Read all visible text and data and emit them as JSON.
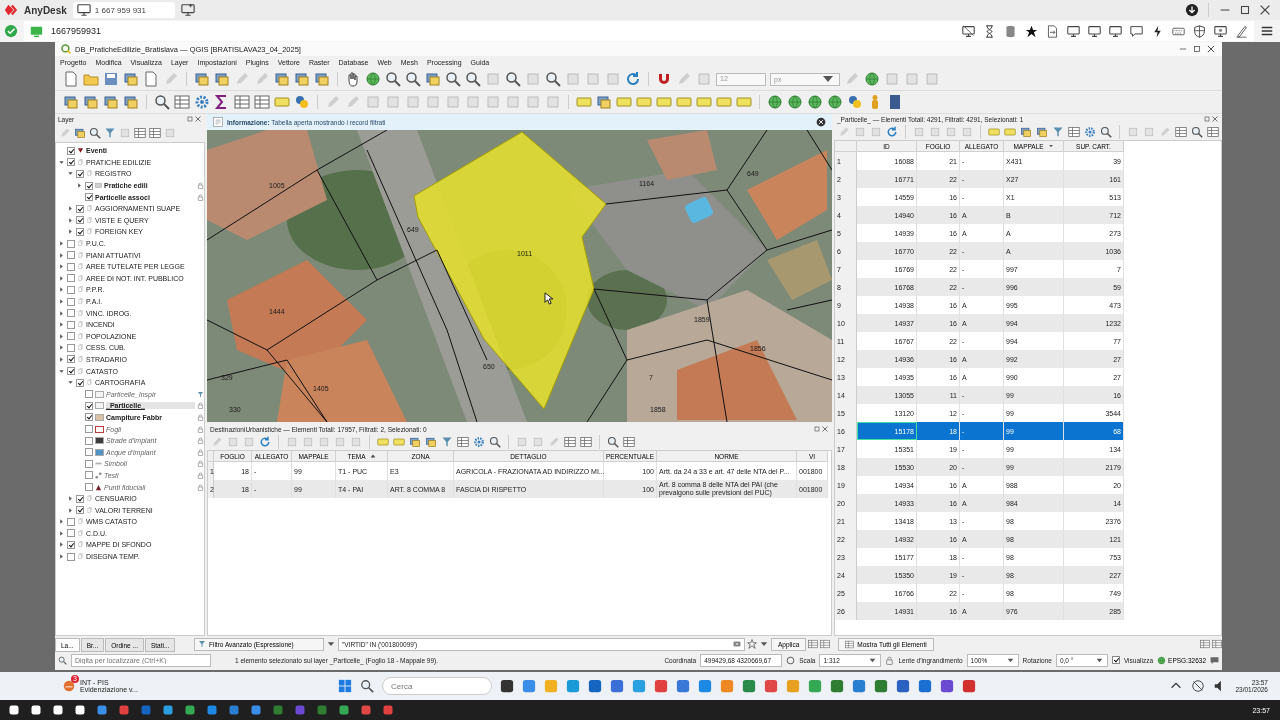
{
  "anydesk": {
    "app_name": "AnyDesk",
    "tab": "1 667 959 931",
    "address": "1667959931"
  },
  "qgis": {
    "title": "DB_PraticheEdilizie_Bratislava — QGIS [BRATISLAVA23_04_2025]",
    "menu": [
      "Progetto",
      "Modifica",
      "Visualizza",
      "Layer",
      "Impostazioni",
      "Plugins",
      "Vettore",
      "Raster",
      "Database",
      "Web",
      "Mesh",
      "Processing",
      "Guida"
    ],
    "toolbar": {
      "size_value": "12",
      "unit": "px"
    }
  },
  "layers_panel": {
    "title": "Layer",
    "tree": [
      {
        "label": "Eventi",
        "kind": "event",
        "checked": true,
        "selected": false
      },
      {
        "label": "PRATICHE EDILIZIE",
        "kind": "group",
        "checked": true,
        "expanded": true,
        "selected": false,
        "children": [
          {
            "label": "REGISTRO",
            "kind": "group",
            "checked": true,
            "expanded": true,
            "selected": false,
            "children": [
              {
                "label": "Pratiche edili",
                "kind": "bold",
                "checked": true,
                "expanded": false,
                "selected": false,
                "indicator": {
                  "kind": "lock"
                },
                "symbol": {
                  "kind": "table",
                  "color": "#d0d0d0"
                }
              },
              {
                "label": "Particelle associ",
                "kind": "bold",
                "checked": true,
                "selected": false,
                "indicator": {
                  "kind": "lock"
                }
              }
            ]
          },
          {
            "label": "AGGIORNAMENTI SUAPE",
            "kind": "group",
            "checked": true,
            "expanded": false,
            "selected": false
          },
          {
            "label": "VISTE E QUERY",
            "kind": "group",
            "checked": true,
            "expanded": false,
            "selected": false
          },
          {
            "label": "FOREIGN KEY",
            "kind": "group",
            "checked": true,
            "expanded": false,
            "selected": false
          }
        ]
      },
      {
        "label": "P.U.C.",
        "kind": "group",
        "checked": false,
        "expanded": false,
        "selected": false
      },
      {
        "label": "PIANI ATTUATIVI",
        "kind": "group",
        "checked": false,
        "expanded": false,
        "selected": false
      },
      {
        "label": "AREE TUTELATE PER LEGGE",
        "kind": "group",
        "checked": false,
        "expanded": false,
        "selected": false
      },
      {
        "label": "AREE DI NOT. INT. PUBBLICO",
        "kind": "group",
        "checked": false,
        "expanded": false,
        "selected": false
      },
      {
        "label": "P.P.R.",
        "kind": "group",
        "checked": false,
        "expanded": false,
        "selected": false
      },
      {
        "label": "P.A.I.",
        "kind": "group",
        "checked": false,
        "expanded": false,
        "selected": false
      },
      {
        "label": "VINC. IDROG.",
        "kind": "group",
        "checked": false,
        "expanded": false,
        "selected": false
      },
      {
        "label": "INCENDI",
        "kind": "group",
        "checked": false,
        "expanded": false,
        "selected": false
      },
      {
        "label": "POPOLAZIONE",
        "kind": "group",
        "checked": false,
        "expanded": false,
        "selected": false
      },
      {
        "label": "CESS. CUB.",
        "kind": "group",
        "checked": false,
        "expanded": false,
        "selected": false
      },
      {
        "label": "STRADARIO",
        "kind": "group",
        "checked": true,
        "expanded": false,
        "selected": false
      },
      {
        "label": "CATASTO",
        "kind": "group",
        "checked": true,
        "expanded": true,
        "selected": false,
        "children": [
          {
            "label": "CARTOGRAFIA",
            "kind": "group",
            "checked": true,
            "expanded": true,
            "selected": false,
            "children": [
              {
                "label": "Particelle_Inspir",
                "kind": "italic",
                "checked": false,
                "selected": false,
                "indicator": {
                  "kind": "filter"
                },
                "symbol": {
                  "kind": "fill",
                  "color": "#f4f4f4"
                }
              },
              {
                "label": "_Particelle_",
                "kind": "bold",
                "checked": true,
                "selected": true,
                "indicator": {
                  "kind": "lock"
                },
                "symbol": {
                  "kind": "fill",
                  "color": "#f4f4f4"
                }
              },
              {
                "label": "Campiture Fabbr",
                "kind": "bold",
                "checked": true,
                "selected": false,
                "indicator": {
                  "kind": "lock"
                },
                "symbol": {
                  "kind": "fill",
                  "color": "#d9c3a5"
                }
              },
              {
                "label": "Fogli",
                "kind": "italic",
                "checked": false,
                "selected": false,
                "indicator": {
                  "kind": "lock"
                },
                "symbol": {
                  "kind": "outline",
                  "color": "#c0393b"
                }
              },
              {
                "label": "Strade d'impiant",
                "kind": "italic",
                "checked": false,
                "selected": false,
                "indicator": {
                  "kind": "lock"
                },
                "symbol": {
                  "kind": "fill",
                  "color": "#3c3c3c"
                }
              },
              {
                "label": "Acque d'impiant",
                "kind": "italic",
                "checked": false,
                "selected": false,
                "indicator": {
                  "kind": "lock"
                },
                "symbol": {
                  "kind": "fill",
                  "color": "#4f93c4"
                }
              },
              {
                "label": "Simboli",
                "kind": "italic",
                "checked": false,
                "selected": false,
                "indicator": {
                  "kind": "lock"
                },
                "symbol": {
                  "kind": "line",
                  "color": "#b0b0b0"
                }
              },
              {
                "label": "Testi",
                "kind": "italic",
                "checked": false,
                "selected": false,
                "indicator": {
                  "kind": "lock"
                },
                "symbol": {
                  "kind": "dots",
                  "color": "#888888"
                }
              },
              {
                "label": "Punti fiduciali",
                "kind": "italic",
                "checked": false,
                "selected": false,
                "indicator": {
                  "kind": "lock"
                },
                "symbol": {
                  "kind": "triangle",
                  "color": "#7a1f2a"
                }
              }
            ]
          },
          {
            "label": "CENSUARIO",
            "kind": "group",
            "checked": true,
            "expanded": false,
            "selected": false
          },
          {
            "label": "VALORI TERRENI",
            "kind": "group",
            "checked": true,
            "expanded": false,
            "selected": false
          }
        ]
      },
      {
        "label": "WMS CATASTO",
        "kind": "group",
        "checked": false,
        "expanded": false,
        "selected": false
      },
      {
        "label": "C.D.U.",
        "kind": "group",
        "checked": false,
        "expanded": false,
        "selected": false
      },
      {
        "label": "MAPPE DI SFONDO",
        "kind": "group",
        "checked": true,
        "expanded": false,
        "selected": false
      },
      {
        "label": "DISEGNA TEMP.",
        "kind": "group",
        "checked": false,
        "expanded": false,
        "selected": false
      }
    ],
    "tabs": [
      {
        "label": "La...",
        "selected": true
      },
      {
        "label": "Br...",
        "selected": false
      },
      {
        "label": "Ordine ...",
        "selected": false
      },
      {
        "label": "Stati...",
        "selected": false
      }
    ]
  },
  "map": {
    "info": "**Informazione:** Tabella aperta mostrando i record filtrati",
    "labels": [
      "1005",
      "649",
      "1011",
      "1164",
      "649",
      "1444",
      "1859",
      "1856",
      "329",
      "1405",
      "650",
      "1858",
      "330",
      "7"
    ]
  },
  "bottom_table": {
    "title": "DestinazioniUrbanistiche — Elementi Totali: 17957,  Filtrati: 2, Selezionati: 0",
    "columns": [
      {
        "label": "FOGLIO",
        "sort": {
          "kind": "none"
        }
      },
      {
        "label": "ALLEGATO",
        "sort": {
          "kind": "none"
        }
      },
      {
        "label": "MAPPALE",
        "sort": {
          "kind": "none"
        }
      },
      {
        "label": "TEMA",
        "sort": {
          "kind": "asc"
        }
      },
      {
        "label": "ZONA",
        "sort": {
          "kind": "none"
        }
      },
      {
        "label": "DETTAGLIO",
        "sort": {
          "kind": "none"
        }
      },
      {
        "label": "PERCENTUALE",
        "sort": {
          "kind": "none"
        }
      },
      {
        "label": "NORME",
        "sort": {
          "kind": "none"
        }
      },
      {
        "label": "VI",
        "sort": {
          "kind": "none"
        }
      }
    ],
    "rows": [
      {
        "number": "1",
        "cells": [
          "18",
          "-",
          "99",
          "T1 - PUC",
          "E3",
          "AGRICOLA - FRAZIONATA AD INDIRIZZO MI...",
          "100",
          "Artt. da 24 a 33 e art. 47 delle NTA del P...",
          "001800"
        ],
        "selected": false
      },
      {
        "number": "2",
        "cells": [
          "18",
          "-",
          "99",
          "T4 - PAI",
          "ART. 8 COMMA 8",
          "FASCIA DI RISPETTO",
          "100",
          "Art. 8 comma 8 delle NTA del PAI (che prevalgono sulle previsioni del PUC)",
          "001800"
        ],
        "selected": false
      }
    ]
  },
  "filter": {
    "mode": "Filtro Avanzato (Espressione)",
    "expression": "\"VIRTID\" IN ('001800099')",
    "apply": "Applica"
  },
  "attribute_table": {
    "title": "_Particelle_ — Elementi Totali: 4291,  Filtrati: 4291, Selezionati: 1",
    "columns": [
      {
        "label": "ID",
        "sort": {
          "kind": "none"
        }
      },
      {
        "label": "FOGLIO",
        "sort": {
          "kind": "none"
        }
      },
      {
        "label": "ALLEGATO",
        "sort": {
          "kind": "none"
        }
      },
      {
        "label": "MAPPALE",
        "sort": {
          "kind": "desc"
        }
      },
      {
        "label": "SUP. CART.",
        "sort": {
          "kind": "none"
        }
      }
    ],
    "rows": [
      {
        "number": "1",
        "cells": [
          "16088",
          "21",
          "-",
          "X431",
          "39"
        ],
        "selected": false
      },
      {
        "number": "2",
        "cells": [
          "16771",
          "22",
          "-",
          "X27",
          "161"
        ],
        "selected": false
      },
      {
        "number": "3",
        "cells": [
          "14559",
          "16",
          "-",
          "X1",
          "513"
        ],
        "selected": false
      },
      {
        "number": "4",
        "cells": [
          "14940",
          "16",
          "A",
          "B",
          "712"
        ],
        "selected": false
      },
      {
        "number": "5",
        "cells": [
          "14939",
          "16",
          "A",
          "A",
          "273"
        ],
        "selected": false
      },
      {
        "number": "6",
        "cells": [
          "16770",
          "22",
          "-",
          "A",
          "1036"
        ],
        "selected": false
      },
      {
        "number": "7",
        "cells": [
          "16769",
          "22",
          "-",
          "997",
          "7"
        ],
        "selected": false
      },
      {
        "number": "8",
        "cells": [
          "16768",
          "22",
          "-",
          "996",
          "59"
        ],
        "selected": false
      },
      {
        "number": "9",
        "cells": [
          "14938",
          "16",
          "A",
          "995",
          "473"
        ],
        "selected": false
      },
      {
        "number": "10",
        "cells": [
          "14937",
          "16",
          "A",
          "994",
          "1232"
        ],
        "selected": false
      },
      {
        "number": "11",
        "cells": [
          "16767",
          "22",
          "-",
          "994",
          "77"
        ],
        "selected": false
      },
      {
        "number": "12",
        "cells": [
          "14936",
          "16",
          "A",
          "992",
          "27"
        ],
        "selected": false
      },
      {
        "number": "13",
        "cells": [
          "14935",
          "16",
          "A",
          "990",
          "27"
        ],
        "selected": false
      },
      {
        "number": "14",
        "cells": [
          "13055",
          "11",
          "-",
          "99",
          "16"
        ],
        "selected": false
      },
      {
        "number": "15",
        "cells": [
          "13120",
          "12",
          "-",
          "99",
          "3544"
        ],
        "selected": false
      },
      {
        "number": "16",
        "cells": [
          "15178",
          "18",
          "-",
          "99",
          "68"
        ],
        "selected": true
      },
      {
        "number": "17",
        "cells": [
          "15351",
          "19",
          "-",
          "99",
          "134"
        ],
        "selected": false
      },
      {
        "number": "18",
        "cells": [
          "15530",
          "20",
          "-",
          "99",
          "2179"
        ],
        "selected": false
      },
      {
        "number": "19",
        "cells": [
          "14934",
          "16",
          "A",
          "988",
          "20"
        ],
        "selected": false
      },
      {
        "number": "20",
        "cells": [
          "14933",
          "16",
          "A",
          "984",
          "14"
        ],
        "selected": false
      },
      {
        "number": "21",
        "cells": [
          "13418",
          "13",
          "-",
          "98",
          "2376"
        ],
        "selected": false
      },
      {
        "number": "22",
        "cells": [
          "14932",
          "16",
          "A",
          "98",
          "121"
        ],
        "selected": false
      },
      {
        "number": "23",
        "cells": [
          "15177",
          "18",
          "-",
          "98",
          "753"
        ],
        "selected": false
      },
      {
        "number": "24",
        "cells": [
          "15350",
          "19",
          "-",
          "98",
          "227"
        ],
        "selected": false
      },
      {
        "number": "25",
        "cells": [
          "16766",
          "22",
          "-",
          "98",
          "749"
        ],
        "selected": false
      },
      {
        "number": "26",
        "cells": [
          "14931",
          "16",
          "A",
          "976",
          "285"
        ],
        "selected": false
      }
    ],
    "show_all": "Mostra Tutti gli Elementi"
  },
  "status_bar": {
    "locator_placeholder": "Digita per localizzare (Ctrl+K)",
    "message": "1 elemento selezionato sul layer _Particelle_ (Foglio 18 - Mappale 99).",
    "coordinate_label": "Coordinata",
    "coordinate": "499429,68  4320669,67",
    "scale_label": "Scala",
    "scale": "1:312",
    "magnifier_label": "Lente d'ingrandimento",
    "magnifier": "100%",
    "rotation_label": "Rotazione",
    "rotation": "0,0 °",
    "render": {
      "label": "Visualizza",
      "checked": true
    },
    "crs": "EPSG:32632"
  },
  "taskbar": {
    "widget": {
      "badge": "3",
      "title": "INT - PIS",
      "subtitle": "Evidenziazione v..."
    },
    "search_placeholder": "Cerca",
    "time": "23:57",
    "date": "23/01/2026"
  },
  "host_taskbar": {
    "time": "23:57"
  }
}
